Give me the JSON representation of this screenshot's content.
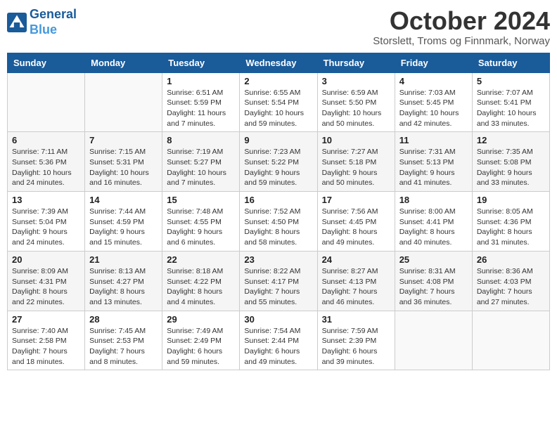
{
  "header": {
    "logo_line1": "General",
    "logo_line2": "Blue",
    "month_title": "October 2024",
    "location": "Storslett, Troms og Finnmark, Norway"
  },
  "weekdays": [
    "Sunday",
    "Monday",
    "Tuesday",
    "Wednesday",
    "Thursday",
    "Friday",
    "Saturday"
  ],
  "weeks": [
    [
      {
        "day": "",
        "info": ""
      },
      {
        "day": "",
        "info": ""
      },
      {
        "day": "1",
        "info": "Sunrise: 6:51 AM\nSunset: 5:59 PM\nDaylight: 11 hours\nand 7 minutes."
      },
      {
        "day": "2",
        "info": "Sunrise: 6:55 AM\nSunset: 5:54 PM\nDaylight: 10 hours\nand 59 minutes."
      },
      {
        "day": "3",
        "info": "Sunrise: 6:59 AM\nSunset: 5:50 PM\nDaylight: 10 hours\nand 50 minutes."
      },
      {
        "day": "4",
        "info": "Sunrise: 7:03 AM\nSunset: 5:45 PM\nDaylight: 10 hours\nand 42 minutes."
      },
      {
        "day": "5",
        "info": "Sunrise: 7:07 AM\nSunset: 5:41 PM\nDaylight: 10 hours\nand 33 minutes."
      }
    ],
    [
      {
        "day": "6",
        "info": "Sunrise: 7:11 AM\nSunset: 5:36 PM\nDaylight: 10 hours\nand 24 minutes."
      },
      {
        "day": "7",
        "info": "Sunrise: 7:15 AM\nSunset: 5:31 PM\nDaylight: 10 hours\nand 16 minutes."
      },
      {
        "day": "8",
        "info": "Sunrise: 7:19 AM\nSunset: 5:27 PM\nDaylight: 10 hours\nand 7 minutes."
      },
      {
        "day": "9",
        "info": "Sunrise: 7:23 AM\nSunset: 5:22 PM\nDaylight: 9 hours\nand 59 minutes."
      },
      {
        "day": "10",
        "info": "Sunrise: 7:27 AM\nSunset: 5:18 PM\nDaylight: 9 hours\nand 50 minutes."
      },
      {
        "day": "11",
        "info": "Sunrise: 7:31 AM\nSunset: 5:13 PM\nDaylight: 9 hours\nand 41 minutes."
      },
      {
        "day": "12",
        "info": "Sunrise: 7:35 AM\nSunset: 5:08 PM\nDaylight: 9 hours\nand 33 minutes."
      }
    ],
    [
      {
        "day": "13",
        "info": "Sunrise: 7:39 AM\nSunset: 5:04 PM\nDaylight: 9 hours\nand 24 minutes."
      },
      {
        "day": "14",
        "info": "Sunrise: 7:44 AM\nSunset: 4:59 PM\nDaylight: 9 hours\nand 15 minutes."
      },
      {
        "day": "15",
        "info": "Sunrise: 7:48 AM\nSunset: 4:55 PM\nDaylight: 9 hours\nand 6 minutes."
      },
      {
        "day": "16",
        "info": "Sunrise: 7:52 AM\nSunset: 4:50 PM\nDaylight: 8 hours\nand 58 minutes."
      },
      {
        "day": "17",
        "info": "Sunrise: 7:56 AM\nSunset: 4:45 PM\nDaylight: 8 hours\nand 49 minutes."
      },
      {
        "day": "18",
        "info": "Sunrise: 8:00 AM\nSunset: 4:41 PM\nDaylight: 8 hours\nand 40 minutes."
      },
      {
        "day": "19",
        "info": "Sunrise: 8:05 AM\nSunset: 4:36 PM\nDaylight: 8 hours\nand 31 minutes."
      }
    ],
    [
      {
        "day": "20",
        "info": "Sunrise: 8:09 AM\nSunset: 4:31 PM\nDaylight: 8 hours\nand 22 minutes."
      },
      {
        "day": "21",
        "info": "Sunrise: 8:13 AM\nSunset: 4:27 PM\nDaylight: 8 hours\nand 13 minutes."
      },
      {
        "day": "22",
        "info": "Sunrise: 8:18 AM\nSunset: 4:22 PM\nDaylight: 8 hours\nand 4 minutes."
      },
      {
        "day": "23",
        "info": "Sunrise: 8:22 AM\nSunset: 4:17 PM\nDaylight: 7 hours\nand 55 minutes."
      },
      {
        "day": "24",
        "info": "Sunrise: 8:27 AM\nSunset: 4:13 PM\nDaylight: 7 hours\nand 46 minutes."
      },
      {
        "day": "25",
        "info": "Sunrise: 8:31 AM\nSunset: 4:08 PM\nDaylight: 7 hours\nand 36 minutes."
      },
      {
        "day": "26",
        "info": "Sunrise: 8:36 AM\nSunset: 4:03 PM\nDaylight: 7 hours\nand 27 minutes."
      }
    ],
    [
      {
        "day": "27",
        "info": "Sunrise: 7:40 AM\nSunset: 2:58 PM\nDaylight: 7 hours\nand 18 minutes."
      },
      {
        "day": "28",
        "info": "Sunrise: 7:45 AM\nSunset: 2:53 PM\nDaylight: 7 hours\nand 8 minutes."
      },
      {
        "day": "29",
        "info": "Sunrise: 7:49 AM\nSunset: 2:49 PM\nDaylight: 6 hours\nand 59 minutes."
      },
      {
        "day": "30",
        "info": "Sunrise: 7:54 AM\nSunset: 2:44 PM\nDaylight: 6 hours\nand 49 minutes."
      },
      {
        "day": "31",
        "info": "Sunrise: 7:59 AM\nSunset: 2:39 PM\nDaylight: 6 hours\nand 39 minutes."
      },
      {
        "day": "",
        "info": ""
      },
      {
        "day": "",
        "info": ""
      }
    ]
  ]
}
